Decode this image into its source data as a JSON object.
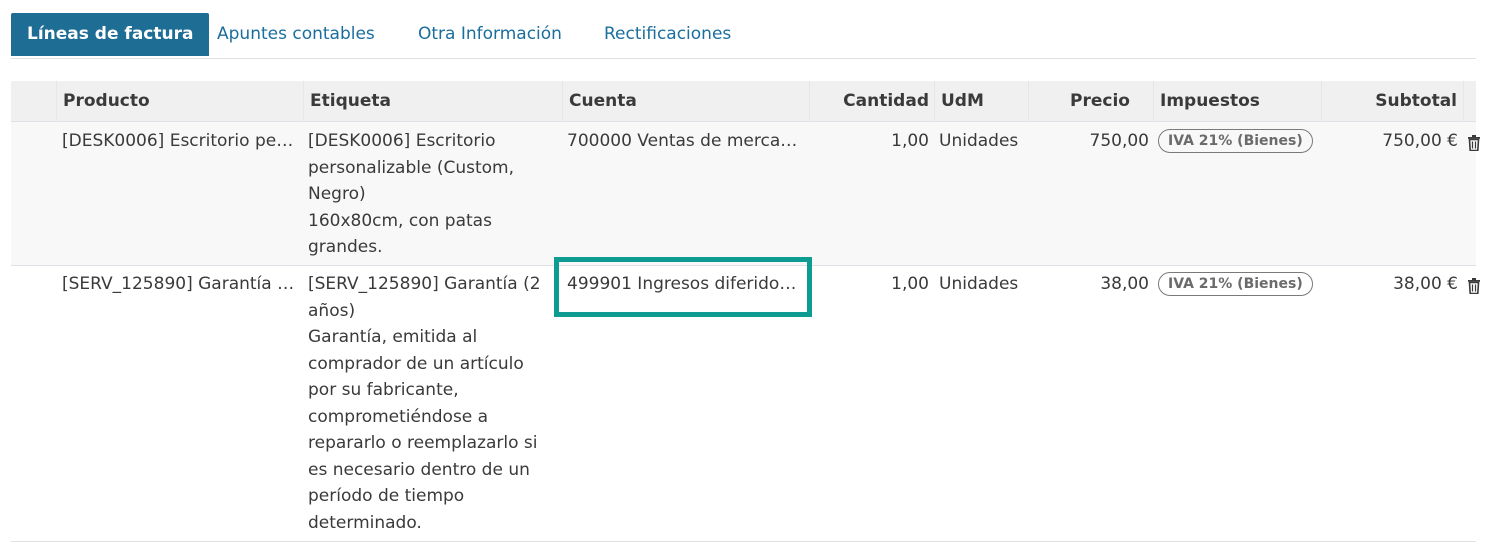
{
  "tabs": [
    {
      "label": "Líneas de factura"
    },
    {
      "label": "Apuntes contables"
    },
    {
      "label": "Otra Información"
    },
    {
      "label": "Rectificaciones"
    }
  ],
  "columns": {
    "producto": "Producto",
    "etiqueta": "Etiqueta",
    "cuenta": "Cuenta",
    "cantidad": "Cantidad",
    "udm": "UdM",
    "precio": "Precio",
    "impuestos": "Impuestos",
    "subtotal": "Subtotal"
  },
  "rows": [
    {
      "producto": "[DESK0006] Escritorio per…",
      "etiqueta": "[DESK0006] Escritorio personalizable (Custom, Negro)\n160x80cm, con patas grandes.",
      "cuenta": "700000 Ventas de merca…",
      "cantidad": "1,00",
      "udm": "Unidades",
      "precio": "750,00",
      "impuestos": "IVA 21% (Bienes)",
      "subtotal": "750,00 €"
    },
    {
      "producto": "[SERV_125890] Garantía …",
      "etiqueta": "[SERV_125890] Garantía (2 años)\nGarantía, emitida al comprador de un artículo por su fabricante, comprometiéndose a repararlo o reemplazarlo si es necesario dentro de un período de tiempo determinado.",
      "cuenta": "499901 Ingresos diferidos…",
      "cantidad": "1,00",
      "udm": "Unidades",
      "precio": "38,00",
      "impuestos": "IVA 21% (Bienes)",
      "subtotal": "38,00 €"
    }
  ],
  "icons": {
    "delete": "trash-icon"
  },
  "colors": {
    "accent": "#1d6d94",
    "highlight": "#0e9c92",
    "link": "#1a6e9e"
  }
}
